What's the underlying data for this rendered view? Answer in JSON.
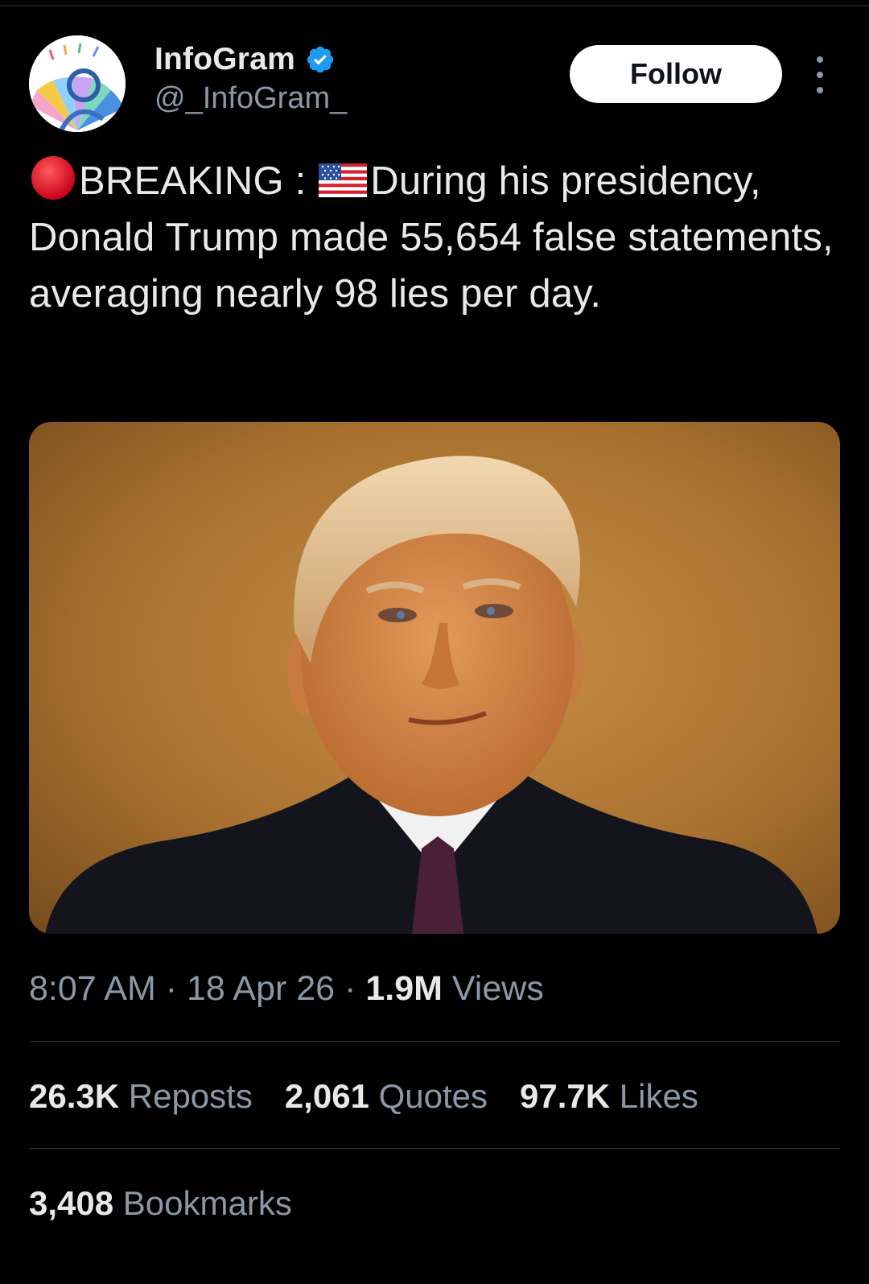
{
  "account": {
    "display_name": "InfoGram",
    "handle": "@_InfoGram_",
    "verified": true,
    "verified_color": "#1d9bf0"
  },
  "header": {
    "follow_label": "Follow",
    "more_icon": "more-vertical-icon"
  },
  "tweet": {
    "badge_icon": "red-circle-icon",
    "prefix": "BREAKING :",
    "flag_icon": "us-flag-icon",
    "text": "During his presidency, Donald Trump made 55,654 false statements, averaging nearly 98 lies per day."
  },
  "media": {
    "type": "photo",
    "background_color": "#b07a35"
  },
  "meta": {
    "time": "8:07 AM",
    "separator": "·",
    "date": "18 Apr 26",
    "views_count": "1.9M",
    "views_label": "Views"
  },
  "stats": [
    {
      "count": "26.3K",
      "label": "Reposts"
    },
    {
      "count": "2,061",
      "label": "Quotes"
    },
    {
      "count": "97.7K",
      "label": "Likes"
    }
  ],
  "bookmarks": {
    "count": "3,408",
    "label": "Bookmarks"
  },
  "colors": {
    "background": "#000000",
    "text_primary": "#e7e9ea",
    "text_secondary": "#8b98a5",
    "divider": "#2f3336",
    "follow_bg": "#ffffff"
  }
}
